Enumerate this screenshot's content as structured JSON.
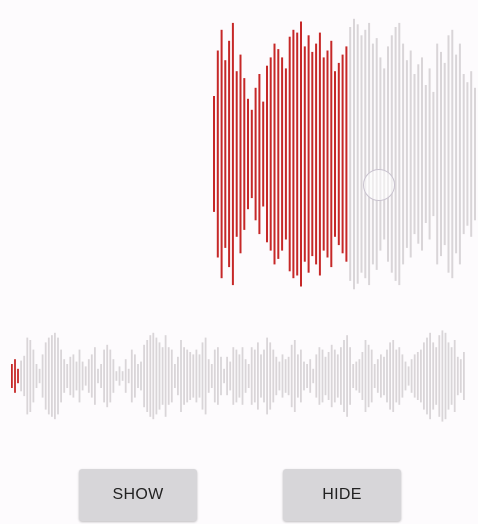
{
  "colors": {
    "background": "#fdfbfd",
    "played": "#c62828",
    "unplayed": "#d9d5d8"
  },
  "top_waveform": {
    "played_fraction": 0.51,
    "bars": [
      0.42,
      0.75,
      0.9,
      0.68,
      0.82,
      0.95,
      0.6,
      0.72,
      0.55,
      0.4,
      0.32,
      0.48,
      0.58,
      0.38,
      0.64,
      0.7,
      0.8,
      0.76,
      0.7,
      0.62,
      0.85,
      0.9,
      0.88,
      0.96,
      0.78,
      0.86,
      0.74,
      0.8,
      0.88,
      0.7,
      0.75,
      0.82,
      0.6,
      0.66,
      0.72,
      0.78,
      0.92,
      0.98,
      0.94,
      0.86,
      0.9,
      0.95,
      0.8,
      0.84,
      0.7,
      0.62,
      0.78,
      0.86,
      0.92,
      0.95,
      0.8,
      0.68,
      0.75,
      0.58,
      0.65,
      0.7,
      0.5,
      0.62,
      0.45,
      0.8,
      0.74,
      0.66,
      0.86,
      0.9,
      0.72,
      0.8,
      0.58,
      0.52,
      0.6,
      0.48
    ]
  },
  "bottom_waveform": {
    "played_fraction": 0.02,
    "bars": [
      0.25,
      0.35,
      0.15,
      0.32,
      0.42,
      0.8,
      0.75,
      0.55,
      0.25,
      0.15,
      0.45,
      0.7,
      0.8,
      0.85,
      0.9,
      0.8,
      0.55,
      0.35,
      0.25,
      0.4,
      0.45,
      0.3,
      0.55,
      0.3,
      0.2,
      0.35,
      0.45,
      0.6,
      0.15,
      0.25,
      0.55,
      0.65,
      0.55,
      0.35,
      0.1,
      0.2,
      0.1,
      0.35,
      0.15,
      0.55,
      0.45,
      0.25,
      0.3,
      0.65,
      0.75,
      0.85,
      0.9,
      0.8,
      0.7,
      0.6,
      0.85,
      0.6,
      0.55,
      0.25,
      0.4,
      0.75,
      0.6,
      0.55,
      0.5,
      0.45,
      0.55,
      0.45,
      0.7,
      0.8,
      0.35,
      0.25,
      0.55,
      0.6,
      0.4,
      0.15,
      0.4,
      0.3,
      0.6,
      0.55,
      0.45,
      0.6,
      0.35,
      0.25,
      0.6,
      0.55,
      0.7,
      0.45,
      0.55,
      0.8,
      0.7,
      0.55,
      0.4,
      0.3,
      0.45,
      0.35,
      0.4,
      0.65,
      0.75,
      0.45,
      0.55,
      0.3,
      0.25,
      0.35,
      0.15,
      0.45,
      0.6,
      0.55,
      0.4,
      0.5,
      0.65,
      0.55,
      0.45,
      0.6,
      0.75,
      0.85,
      0.6,
      0.25,
      0.3,
      0.35,
      0.5,
      0.75,
      0.65,
      0.55,
      0.25,
      0.35,
      0.45,
      0.4,
      0.55,
      0.7,
      0.75,
      0.55,
      0.6,
      0.45,
      0.3,
      0.2,
      0.35,
      0.45,
      0.5,
      0.55,
      0.7,
      0.8,
      0.9,
      0.7,
      0.6,
      0.85,
      0.95,
      0.9,
      0.7,
      0.6,
      0.75,
      0.4,
      0.35,
      0.5
    ]
  },
  "buttons": {
    "show_label": "SHOW",
    "hide_label": "HIDE"
  }
}
